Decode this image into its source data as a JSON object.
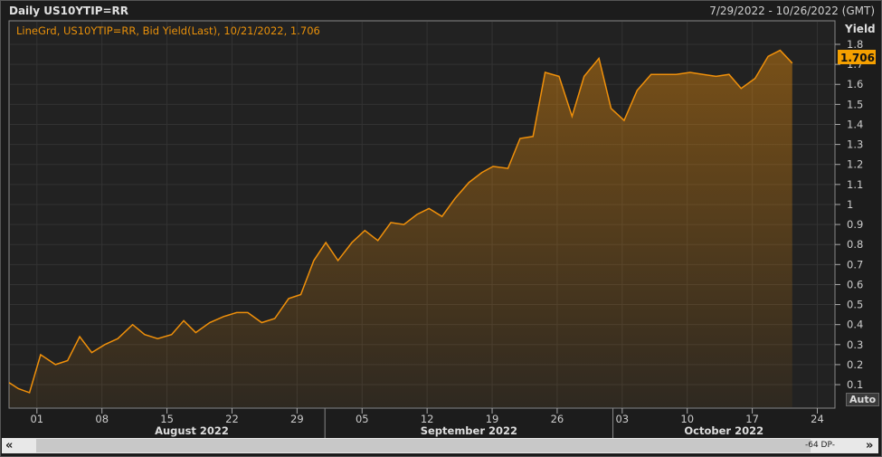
{
  "header": {
    "title": "Daily US10YTIP=RR",
    "date_range": "7/29/2022 - 10/26/2022 (GMT)"
  },
  "legend": "LineGrd, US10YTIP=RR, Bid Yield(Last),  10/21/2022, 1.706",
  "last_value_label": "1.706",
  "auto_button": "Auto",
  "scrollbar": {
    "left": "«",
    "right": "»",
    "points": "-64 DP-"
  },
  "colors": {
    "line": "#f0900a",
    "background": "#222222",
    "grid": "#333333",
    "badge": "#f5a000"
  },
  "chart_data": {
    "type": "area",
    "title": "Daily US10YTIP=RR",
    "ylabel": "Yield",
    "ylim": [
      0,
      1.8
    ],
    "y_ticks": [
      "0.1",
      "0.2",
      "0.3",
      "0.4",
      "0.5",
      "0.6",
      "0.7",
      "0.8",
      "0.9",
      "1",
      "1.1",
      "1.2",
      "1.3",
      "1.4",
      "1.5",
      "1.6",
      "1.7",
      "1.8"
    ],
    "x_unit": "days since 2022-07-29",
    "x_ticks": [
      {
        "label": "01",
        "day": 3
      },
      {
        "label": "08",
        "day": 10
      },
      {
        "label": "15",
        "day": 17
      },
      {
        "label": "22",
        "day": 24
      },
      {
        "label": "29",
        "day": 31
      },
      {
        "label": "05",
        "day": 38
      },
      {
        "label": "12",
        "day": 45
      },
      {
        "label": "19",
        "day": 52
      },
      {
        "label": "26",
        "day": 59
      },
      {
        "label": "03",
        "day": 66
      },
      {
        "label": "10",
        "day": 73
      },
      {
        "label": "17",
        "day": 80
      },
      {
        "label": "24",
        "day": 87
      }
    ],
    "months": [
      {
        "label": "August 2022",
        "start": 3,
        "end": 34
      },
      {
        "label": "September 2022",
        "start": 34,
        "end": 65
      },
      {
        "label": "October 2022",
        "start": 65,
        "end": 90
      }
    ],
    "x": [
      0,
      1,
      2.2,
      3.4,
      5,
      6.3,
      7.6,
      8.9,
      10.3,
      11.7,
      13.3,
      14.6,
      16,
      17.5,
      18.8,
      20.1,
      21.6,
      23.1,
      24.5,
      25.7,
      27.2,
      28.6,
      30.1,
      31.4,
      32.8,
      34.1,
      35.4,
      36.9,
      38.3,
      39.7,
      41.1,
      42.5,
      43.9,
      45.2,
      46.6,
      48,
      49.5,
      50.9,
      52.1,
      53.7,
      55,
      56.4,
      57.7,
      59.2,
      60.6,
      61.9,
      63.5,
      64.8,
      66.2,
      67.6,
      69.1,
      70.5,
      71.8,
      73.3,
      74.7,
      76.1,
      77.5,
      78.8,
      80.3,
      81.7,
      83,
      84.3
    ],
    "values": [
      0.11,
      0.08,
      0.06,
      0.25,
      0.2,
      0.22,
      0.34,
      0.26,
      0.3,
      0.33,
      0.4,
      0.35,
      0.33,
      0.35,
      0.42,
      0.36,
      0.41,
      0.44,
      0.46,
      0.46,
      0.41,
      0.43,
      0.53,
      0.55,
      0.72,
      0.81,
      0.72,
      0.81,
      0.87,
      0.82,
      0.91,
      0.9,
      0.95,
      0.98,
      0.94,
      1.03,
      1.11,
      1.16,
      1.19,
      1.18,
      1.33,
      1.34,
      1.66,
      1.64,
      1.44,
      1.64,
      1.73,
      1.48,
      1.42,
      1.57,
      1.65,
      1.65,
      1.65,
      1.66,
      1.65,
      1.64,
      1.65,
      1.58,
      1.63,
      1.74,
      1.77,
      1.706
    ]
  }
}
